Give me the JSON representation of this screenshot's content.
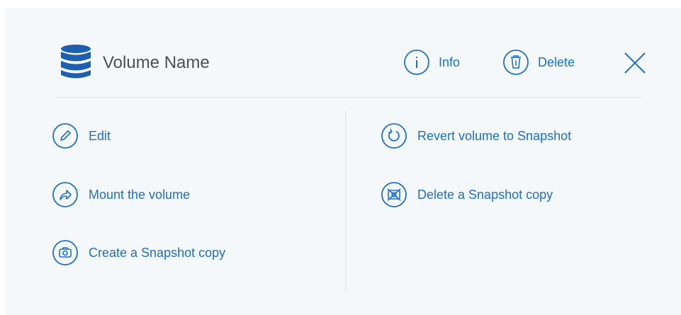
{
  "colors": {
    "accent": "#1f6fc5",
    "panel_background": "#f5f8fb",
    "title_text": "#4a4f56",
    "separator": "#dde2e8"
  },
  "header": {
    "icon": "database-icon",
    "title": "Volume Name",
    "info_label": "Info",
    "info_icon": "info-icon",
    "delete_label": "Delete",
    "delete_icon": "trash-icon",
    "close_icon": "close-icon"
  },
  "actions": {
    "left": [
      {
        "label": "Edit",
        "icon": "pencil-icon"
      },
      {
        "label": "Mount the volume",
        "icon": "share-arrow-icon"
      },
      {
        "label": "Create a Snapshot copy",
        "icon": "camera-icon"
      }
    ],
    "right": [
      {
        "label": "Revert volume to Snapshot",
        "icon": "revert-icon"
      },
      {
        "label": "Delete a Snapshot copy",
        "icon": "delete-snapshot-icon"
      }
    ]
  }
}
